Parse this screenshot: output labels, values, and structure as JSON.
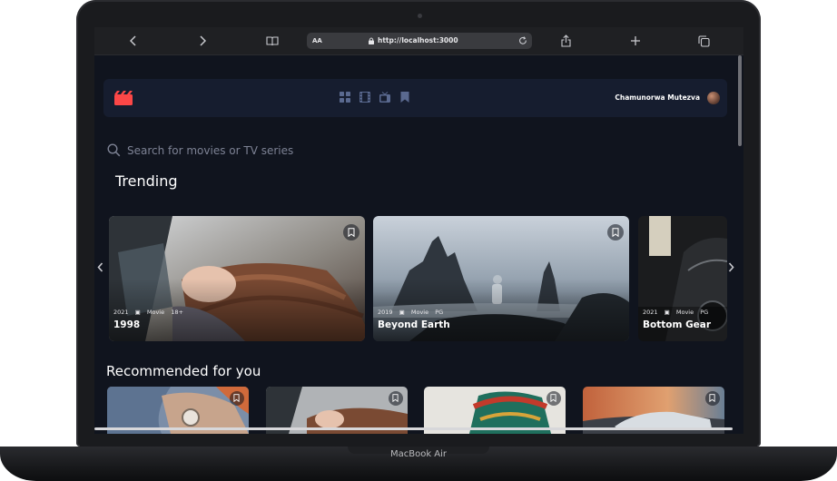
{
  "device": {
    "label": "MacBook Air"
  },
  "browser": {
    "text_size_label": "AA",
    "url": "http://localhost:3000",
    "icons": [
      "back-icon",
      "forward-icon",
      "book-icon",
      "lock-icon",
      "reload-icon",
      "share-icon",
      "plus-icon",
      "tabs-icon"
    ]
  },
  "app": {
    "user_name": "Chamunorwa Mutezva",
    "search": {
      "placeholder": "Search for movies or TV series",
      "value": ""
    },
    "nav_icons": [
      "home-grid-icon",
      "movies-icon",
      "tv-series-icon",
      "bookmark-icon"
    ],
    "trending": {
      "title": "Trending",
      "cards": [
        {
          "year": "2021",
          "category": "Movie",
          "rating": "18+",
          "title": "1998"
        },
        {
          "year": "2019",
          "category": "Movie",
          "rating": "PG",
          "title": "Beyond Earth"
        },
        {
          "year": "2021",
          "category": "Movie",
          "rating": "PG",
          "title": "Bottom Gear"
        }
      ]
    },
    "recommended": {
      "title": "Recommended for you"
    },
    "colors": {
      "background": "#10141e",
      "surface": "#161d2f",
      "accent": "#fc4747",
      "muted": "#5a698f"
    }
  }
}
